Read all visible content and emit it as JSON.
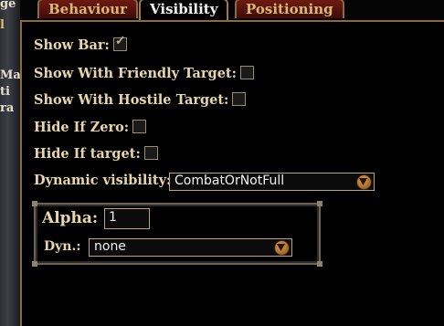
{
  "left_fragments": [
    "ge",
    "l",
    "Ma",
    "ti",
    "ra"
  ],
  "tabs": [
    {
      "label": "Behaviour",
      "state": "inactive"
    },
    {
      "label": "Visibility",
      "state": "active"
    },
    {
      "label": "Positioning",
      "state": "inactive"
    }
  ],
  "options": [
    {
      "label": "Show Bar:",
      "checked": true
    },
    {
      "label": "Show With Friendly Target:",
      "checked": false
    },
    {
      "label": "Show With Hostile Target:",
      "checked": false
    },
    {
      "label": "Hide If Zero:",
      "checked": false
    },
    {
      "label": "Hide If target:",
      "checked": false
    }
  ],
  "dynamic_visibility": {
    "label": "Dynamic visibility:",
    "value": "CombatOrNotFull"
  },
  "alpha": {
    "label": "Alpha:",
    "value": "1"
  },
  "dyn": {
    "label": "Dyn.:",
    "value": "none"
  },
  "colors": {
    "tab_inactive": "#6e1a12",
    "border_gold": "#8a6a45",
    "text_gold": "#e8d6a8"
  }
}
